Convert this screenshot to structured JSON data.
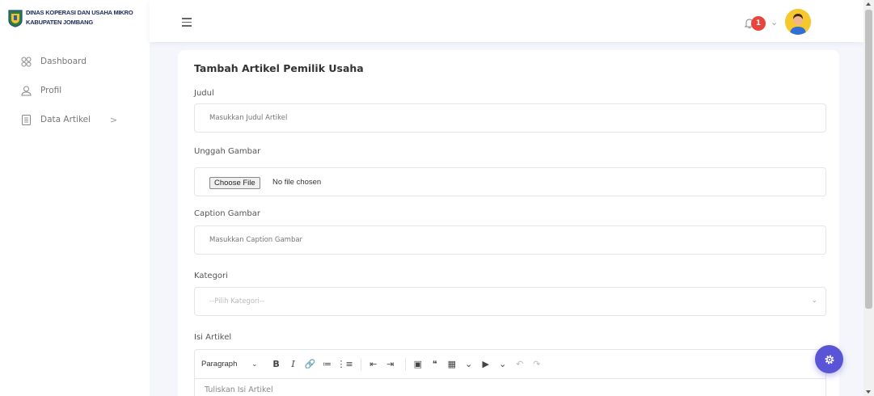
{
  "brand": {
    "line1": "DINAS KOPERASI DAN USAHA MIKRO",
    "line2": "KABUPATEN JOMBANG"
  },
  "sidebar": {
    "items": [
      {
        "label": "Dashboard",
        "icon": "grid-icon"
      },
      {
        "label": "Profil",
        "icon": "user-icon"
      },
      {
        "label": "Data Artikel",
        "icon": "document-icon",
        "chevron": ">"
      }
    ]
  },
  "header": {
    "notification_count": "1",
    "chevron": "⌄"
  },
  "form": {
    "title": "Tambah Artikel Pemilik Usaha",
    "judul": {
      "label": "Judul",
      "placeholder": "Masukkan Judul Artikel"
    },
    "gambar": {
      "label": "Unggah Gambar",
      "button": "Choose File",
      "status": "No file chosen"
    },
    "caption": {
      "label": "Caption Gambar",
      "placeholder": "Masukkan Caption Gambar"
    },
    "kategori": {
      "label": "Kategori",
      "placeholder": "--Pilih Kategori--"
    },
    "isi": {
      "label": "Isi Artikel",
      "placeholder": "Tuliskan Isi Artikel"
    }
  },
  "editor": {
    "paragraph_label": "Paragraph",
    "tools": [
      "B",
      "I",
      "🔗",
      "≔",
      "⋮≡",
      "⇤",
      "⇥",
      "▣",
      "❝",
      "▦",
      "▶",
      "↶",
      "↷"
    ]
  },
  "colors": {
    "accent": "#5a55d6",
    "badge": "#e8453c",
    "avatar": "#f6c82b"
  }
}
